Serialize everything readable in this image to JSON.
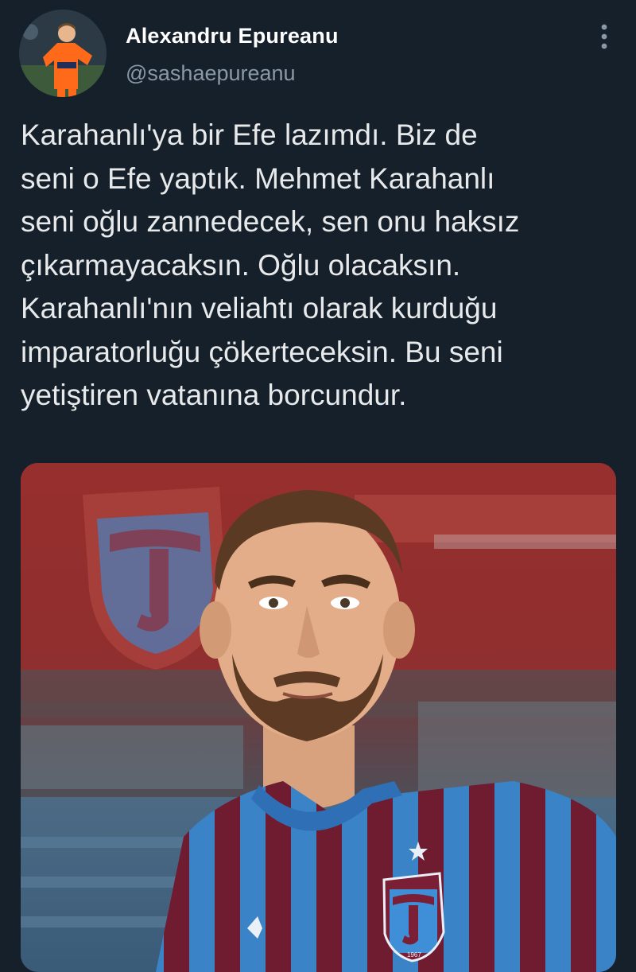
{
  "author": {
    "display_name": "Alexandru Epureanu",
    "handle": "@sashaepureanu",
    "avatar_icon": "player-avatar"
  },
  "menu": {
    "icon": "more-options-icon"
  },
  "tweet": {
    "text": "Karahanlı'ya bir Efe lazımdı. Biz de\nseni o Efe yaptık. Mehmet Karahanlı\nseni oğlu zannedecek, sen onu haksız\nçıkarmayacaksın. Oğlu olacaksın.\nKarahanlı'nın veliahtı olarak kurduğu\nimparatorluğu çökerteceksin. Bu seni\nyetiştiren vatanına borcundur."
  },
  "media": {
    "crest_year": "1967",
    "colors": {
      "claret": "#7a1f35",
      "blue": "#3f8fd8",
      "stadium_red": "#9a2c2b"
    }
  }
}
